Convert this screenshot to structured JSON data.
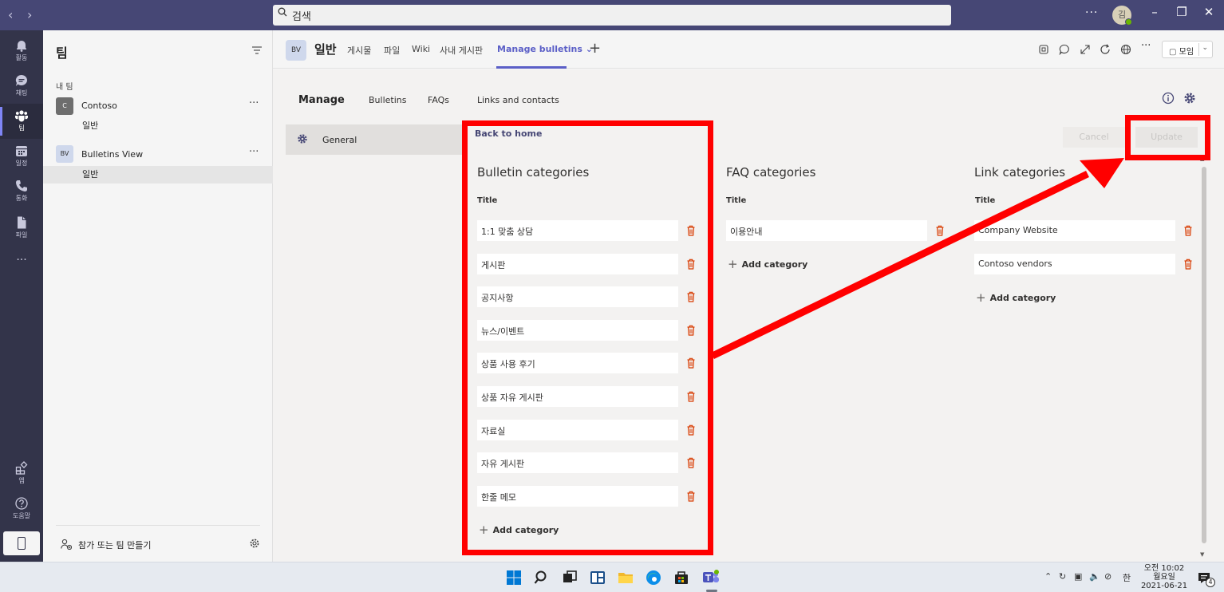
{
  "titlebar": {
    "search_text": "검색",
    "avatar_initial": "김",
    "more": "···"
  },
  "rail": {
    "items": [
      {
        "label": "활동",
        "icon": "bell-icon"
      },
      {
        "label": "채팅",
        "icon": "chat-icon"
      },
      {
        "label": "팀",
        "icon": "teams-icon"
      },
      {
        "label": "일정",
        "icon": "calendar-icon"
      },
      {
        "label": "통화",
        "icon": "phone-icon"
      },
      {
        "label": "파일",
        "icon": "file-icon"
      },
      {
        "label": "···",
        "icon": "more-icon"
      },
      {
        "label": "앱",
        "icon": "apps-icon"
      },
      {
        "label": "도움말",
        "icon": "help-icon"
      }
    ]
  },
  "teams": {
    "title": "팀",
    "section": "내 팀",
    "list": [
      {
        "avatar": "C",
        "name": "Contoso",
        "more": "···",
        "channel": "일반"
      },
      {
        "avatar": "BV",
        "name": "Bulletins View",
        "more": "···",
        "channel": "일반"
      }
    ],
    "join_label": "참가 또는 팀 만들기"
  },
  "channel_header": {
    "avatar": "BV",
    "name": "일반",
    "tabs": [
      "게시물",
      "파일",
      "Wiki",
      "사내 게시판",
      "Manage bulletins ⌄"
    ],
    "add": "+",
    "meet_label": "모임",
    "meet_caret": "⌄"
  },
  "app": {
    "nav_title": "Manage",
    "nav_items": [
      "Bulletins",
      "FAQs",
      "Links and contacts"
    ],
    "general_label": "General",
    "back_link": "Back to home",
    "cancel_label": "Cancel",
    "update_label": "Update",
    "title_label": "Title",
    "add_category_label": "Add category",
    "bulletin_heading": "Bulletin categories",
    "bulletin_categories": [
      "1:1 맞춤 상담",
      "게시판",
      "공지사항",
      "뉴스/이벤트",
      "상품 사용 후기",
      "상품 자유 게시판",
      "자료실",
      "자유 게시판",
      "한줄 메모"
    ],
    "faq_heading": "FAQ categories",
    "faq_categories": [
      "이용안내"
    ],
    "link_heading": "Link categories",
    "link_categories": [
      "Company Website",
      "Contoso vendors"
    ]
  },
  "taskbar": {
    "ime": "한",
    "time": "오전 10:02",
    "day": "월요일",
    "date": "2021-06-21",
    "notif_count": "4"
  },
  "colors": {
    "titlebar": "#464775",
    "rail": "#33344a",
    "accent": "#5b5fc7",
    "annotation": "#ff0000",
    "trash": "#d83b01"
  }
}
